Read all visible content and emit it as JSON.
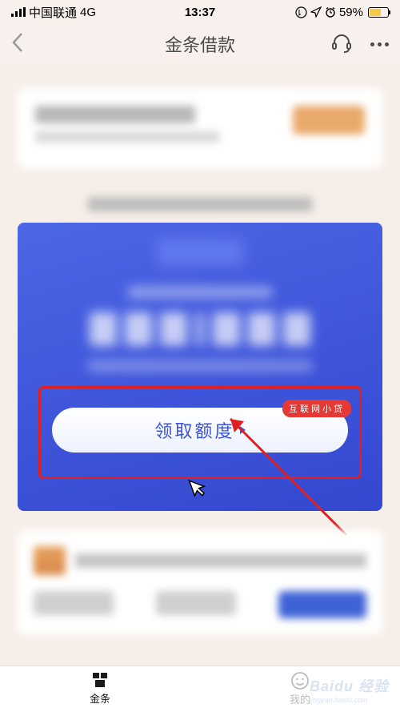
{
  "status": {
    "carrier": "中国联通",
    "network": "4G",
    "time": "13:37",
    "battery_pct": "59%"
  },
  "nav": {
    "title": "金条借款"
  },
  "promo": {
    "button_label": "领取额度",
    "badge_label": "互联网小贷"
  },
  "tabs": {
    "tab1": "金条",
    "tab2": "我的"
  },
  "watermark": {
    "brand": "Baidu 经验",
    "sub": "jingyan.baidu.com"
  }
}
